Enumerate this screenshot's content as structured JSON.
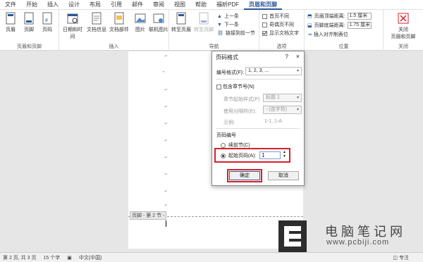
{
  "tabs": [
    "文件",
    "开始",
    "插入",
    "设计",
    "布局",
    "引用",
    "邮件",
    "审阅",
    "视图",
    "帮助",
    "福昕PDF",
    "页眉和页脚"
  ],
  "ribbon": {
    "group1": {
      "label": "页眉和页脚",
      "buttons": [
        "页眉",
        "页脚",
        "页码"
      ]
    },
    "group2": {
      "label": "插入",
      "buttons": [
        "日期和时间",
        "文档信息",
        "文档部件",
        "图片",
        "联机图片"
      ]
    },
    "group3": {
      "label": "导航",
      "buttons": [
        "转至页眉",
        "转至页脚"
      ],
      "small": [
        "上一条",
        "下一条",
        "链接到前一节"
      ]
    },
    "group4": {
      "label": "选项",
      "options": [
        {
          "label": "首页不同",
          "checked": false
        },
        {
          "label": "奇偶页不同",
          "checked": false
        },
        {
          "label": "显示文档文字",
          "checked": true
        }
      ]
    },
    "group5": {
      "label": "位置",
      "header_label": "页眉顶端距离:",
      "header_value": "1.5 厘米",
      "footer_label": "页脚底端距离:",
      "footer_value": "1.75 厘米",
      "align_tab": "插入对齐制表位"
    },
    "group6": {
      "label": "关闭",
      "close_label": "关闭",
      "close_label2": "页眉和页脚"
    }
  },
  "document": {
    "footer_tag": "页脚 - 第 2 节 -"
  },
  "dialog": {
    "title": "页码格式",
    "help": "?",
    "close": "×",
    "number_format_label": "编号格式(F):",
    "number_format_value": "1, 2, 3, ...",
    "include_chapter_label": "包含章节号(N)",
    "chapter_style_label": "章节起始样式(P)",
    "chapter_style_value": "标题 1",
    "separator_label": "使用分隔符(E):",
    "separator_value": "- (连字符)",
    "example_label": "示例:",
    "example_value": "1-1, 1-A",
    "numbering_heading": "页码编号",
    "continue_label": "续前节(C)",
    "start_at_label": "起始页码(A):",
    "start_at_value": "1",
    "ok_label": "确定",
    "cancel_label": "取消"
  },
  "statusbar": {
    "page": "第 2 页, 共 3 页",
    "words": "15 个字",
    "lang": "中文(中国)",
    "focus": "专注"
  },
  "watermark": {
    "title": "电脑笔记网",
    "url": "www.pcbiji.com"
  },
  "colors": {
    "accent": "#2b579a",
    "highlight": "#d6202a"
  }
}
